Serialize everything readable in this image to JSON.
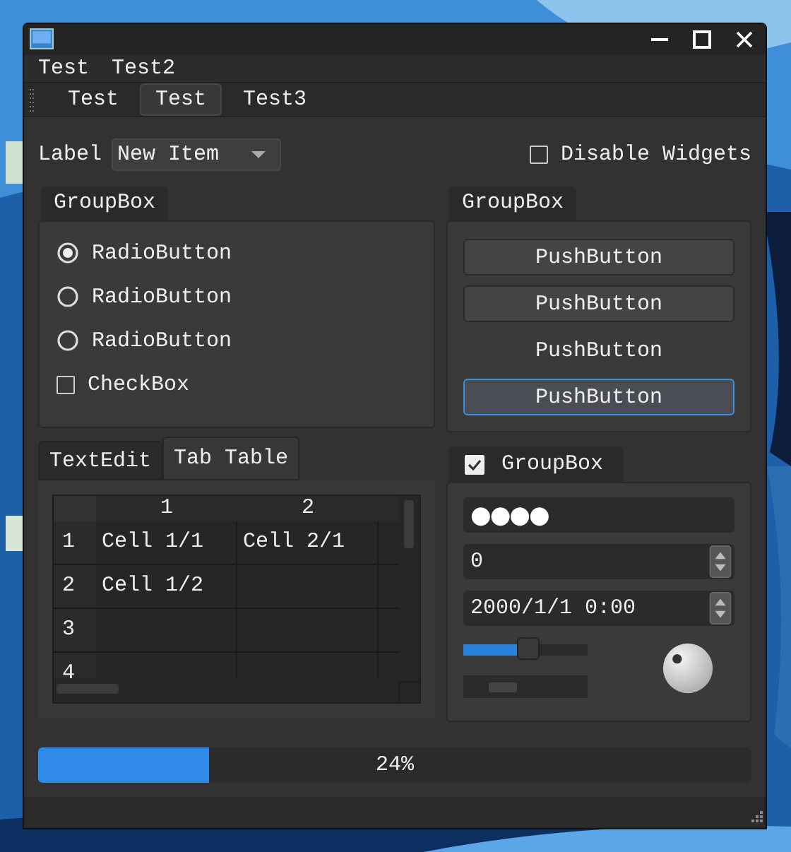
{
  "menu": [
    "Test",
    "Test2"
  ],
  "toolbar": [
    {
      "label": "Test",
      "selected": false
    },
    {
      "label": "Test",
      "selected": true
    },
    {
      "label": "Test3",
      "selected": false
    }
  ],
  "combo": {
    "label": "Label",
    "value": "New Item"
  },
  "disable_widgets": {
    "label": "Disable Widgets",
    "checked": false
  },
  "group_options": {
    "title": "GroupBox",
    "items": [
      {
        "kind": "radio",
        "label": "RadioButton",
        "checked": true
      },
      {
        "kind": "radio",
        "label": "RadioButton",
        "checked": false
      },
      {
        "kind": "radio",
        "label": "RadioButton",
        "checked": false
      },
      {
        "kind": "checkbox",
        "label": "CheckBox",
        "checked": false
      }
    ]
  },
  "group_buttons": {
    "title": "GroupBox",
    "buttons": [
      {
        "label": "PushButton",
        "kind": "normal"
      },
      {
        "label": "PushButton",
        "kind": "normal"
      },
      {
        "label": "PushButton",
        "kind": "flat"
      },
      {
        "label": "PushButton",
        "kind": "focused"
      }
    ]
  },
  "tabs": [
    {
      "label": "TextEdit",
      "selected": false
    },
    {
      "label": "Tab Table",
      "selected": true
    }
  ],
  "table": {
    "columns": [
      "1",
      "2"
    ],
    "rows": [
      {
        "header": "1",
        "cells": [
          "Cell 1/1",
          "Cell 2/1"
        ]
      },
      {
        "header": "2",
        "cells": [
          "Cell 1/2"
        ]
      },
      {
        "header": "3"
      },
      {
        "header": "4"
      }
    ]
  },
  "group_inputs": {
    "title": "GroupBox",
    "checked": true,
    "password": "●●●●",
    "spin_value": "0",
    "datetime": "2000/1/1 0:00",
    "slider": {
      "level": 0.57
    }
  },
  "progress": {
    "level": 0.24,
    "reading": "24%"
  }
}
